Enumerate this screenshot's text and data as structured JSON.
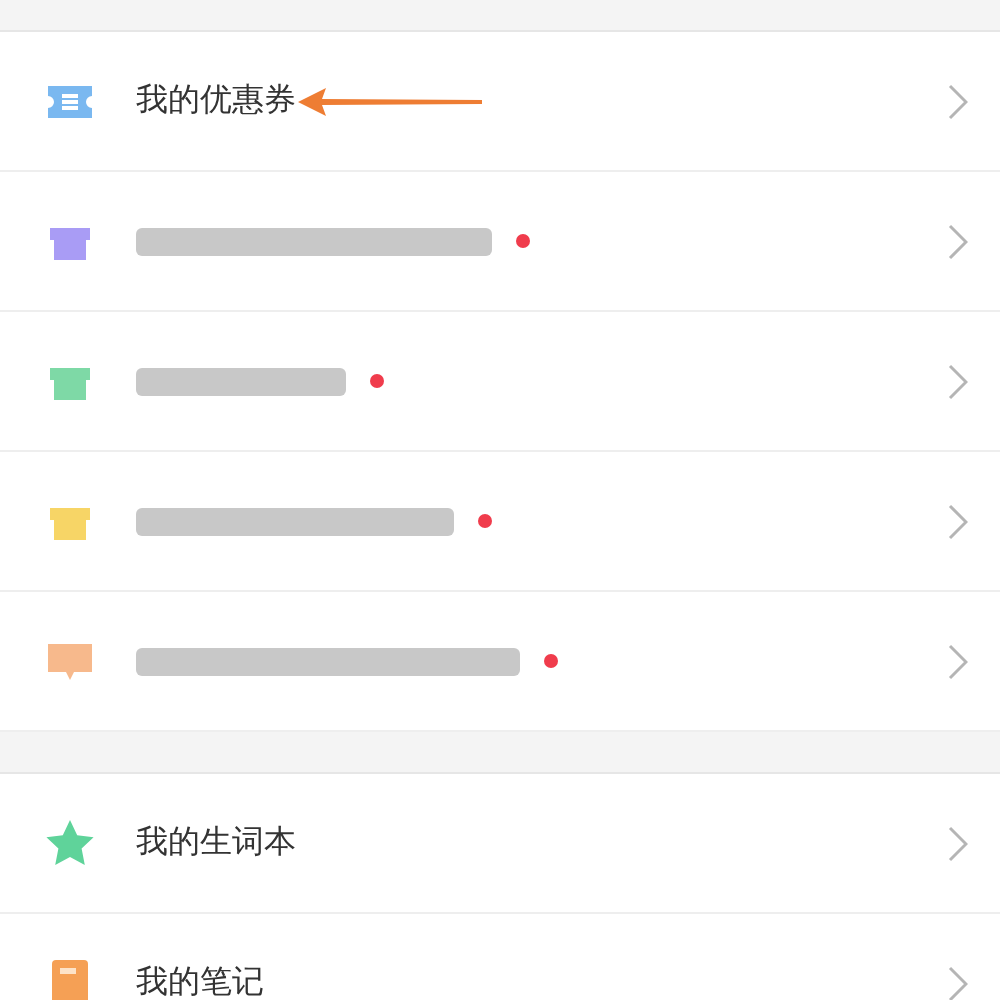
{
  "sections": [
    {
      "items": [
        {
          "kind": "text",
          "label": "我的优惠券",
          "color": "#7ab8f0",
          "badge": false,
          "pointer": true
        },
        {
          "kind": "redacted",
          "color": "#a99cf5",
          "badge": true,
          "pointer": false
        },
        {
          "kind": "redacted",
          "color": "#7ed9a6",
          "badge": true,
          "pointer": false
        },
        {
          "kind": "redacted",
          "color": "#f7d566",
          "badge": true,
          "pointer": false
        },
        {
          "kind": "redacted",
          "color": "#f7b98c",
          "badge": true,
          "pointer": false
        }
      ]
    },
    {
      "items": [
        {
          "kind": "text",
          "label": "我的生词本",
          "color": "#5fd39a",
          "badge": false,
          "pointer": false
        },
        {
          "kind": "text",
          "label": "我的笔记",
          "color": "#f5a055",
          "badge": false,
          "pointer": false
        }
      ]
    }
  ]
}
